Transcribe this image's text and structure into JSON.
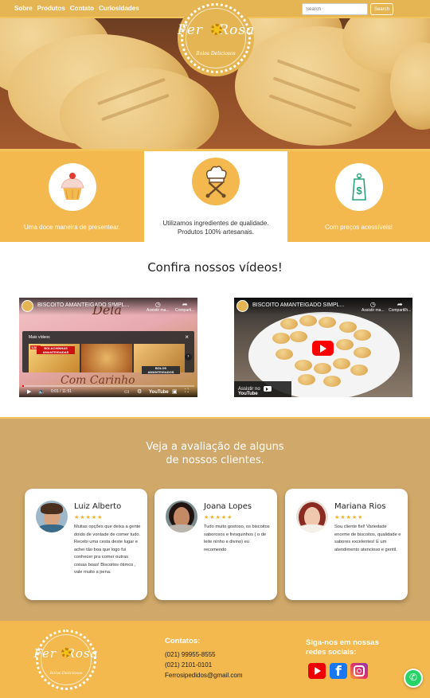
{
  "nav": {
    "links": [
      "Sobre",
      "Produtos",
      "Contato",
      "Curiosidades"
    ],
    "search_placeholder": "Search",
    "search_button": "Search"
  },
  "brand": {
    "name": "Ferro Rosa",
    "tagline": "Bolos Deliciosos",
    "accent_color": "#f3b84e",
    "dark_accent_color": "#d0a86a"
  },
  "features": [
    {
      "icon": "cupcake-icon",
      "text": "Uma doce maneira de presentear."
    },
    {
      "icon": "chef-hat-utensils-icon",
      "text": "Utilizamos ingredientes de qualidade.\nProdutos 100% artesanais."
    },
    {
      "icon": "price-tag-icon",
      "text": "Com preços acessíveis!"
    }
  ],
  "videos": {
    "title": "Confira nossos vídeos!",
    "video1": {
      "title": "BISCOITO AMANTEIGADO SIMPL...",
      "watch_later": "Assistir ma...",
      "share": "Comparti...",
      "overlay_text_top": "Dela",
      "overlay_text_bottom": "Com Carinho",
      "more_videos": "Mais vídeos",
      "thumb_badge": "LIVE",
      "thumb_label": "BOLACHINHAS AMANTEIGADAS",
      "thumb3_label": "BOLOS AMANTEIGADOS",
      "time": "0:01 / 11:51",
      "progress": 0.01
    },
    "video2": {
      "title": "BISCOITO AMANTEIGADO SIMPL...",
      "watch_later": "Assistir ma...",
      "share": "Compartilh...",
      "watch_on": "Assistir no"
    },
    "youtube_label": "YouTube"
  },
  "testimonials": {
    "title_line1": "Veja a avaliação de alguns",
    "title_line2": "de nossos clientes.",
    "cards": [
      {
        "name": "Luiz Alberto",
        "stars": "★★★★★",
        "text": "Muitas opções que deixa a gente doido de vontade de comer tudo. Recebi uma cesta deste lugar e achei tão boa que logo fui conhecer pra comer outras coisas boas! Biscoitos ótimos , vale muito a pena."
      },
      {
        "name": "Joana Lopes",
        "stars": "★★★★★",
        "text": "Tudo muito gostoso, os biscoitos saborosos e fresquinhos ( o de leite ninho e divino) eu recomendo"
      },
      {
        "name": "Mariana Rios",
        "stars": "★★★★★",
        "text": "Sou cliente fiel! Variedade enorme de biscoitos, qualidade e sabores excelentes! E um atendimento atencioso e gentil."
      }
    ]
  },
  "footer": {
    "contacts_title": "Contatos:",
    "phone1": "(021) 99955-8555",
    "phone2": "(021) 2101-0101",
    "email": "Ferrosipedidos@gmail.com",
    "social_title_line1": "Siga-nos em nossas",
    "social_title_line2": "redes sociais:",
    "social_icons": [
      "youtube-icon",
      "facebook-icon",
      "instagram-icon"
    ],
    "fb_glyph": "f"
  }
}
